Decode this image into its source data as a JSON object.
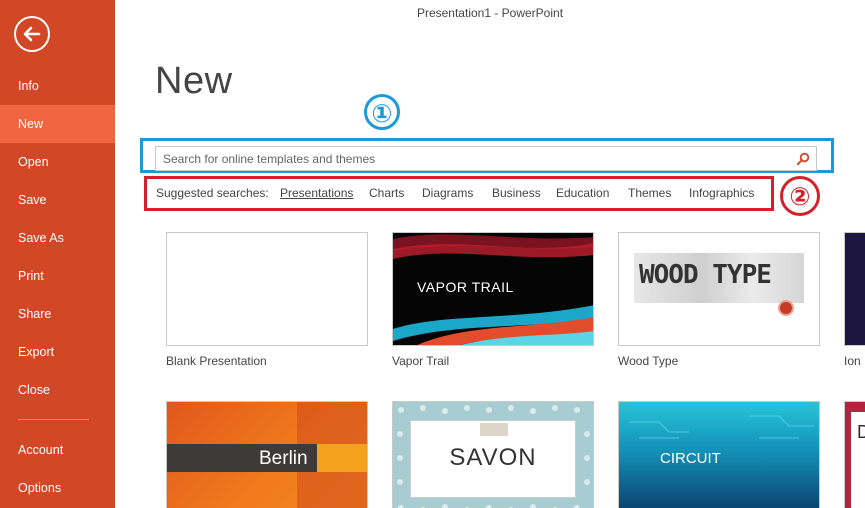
{
  "window": {
    "title": "Presentation1 - PowerPoint"
  },
  "sidebar": {
    "back_icon": "back-arrow-icon",
    "items": [
      {
        "label": "Info"
      },
      {
        "label": "New",
        "active": true
      },
      {
        "label": "Open"
      },
      {
        "label": "Save"
      },
      {
        "label": "Save As"
      },
      {
        "label": "Print"
      },
      {
        "label": "Share"
      },
      {
        "label": "Export"
      },
      {
        "label": "Close"
      },
      {
        "label": "Account"
      },
      {
        "label": "Options"
      }
    ]
  },
  "main": {
    "title": "New",
    "search": {
      "placeholder": "Search for online templates and themes",
      "value": "",
      "icon": "search-icon"
    },
    "suggested": {
      "label": "Suggested searches:",
      "items": [
        "Presentations",
        "Charts",
        "Diagrams",
        "Business",
        "Education",
        "Themes",
        "Infographics"
      ]
    },
    "annotations": {
      "one": "①",
      "two": "②"
    },
    "templates": [
      {
        "name": "Blank Presentation",
        "thumb_text": ""
      },
      {
        "name": "Vapor Trail",
        "thumb_text": "VAPOR TRAIL"
      },
      {
        "name": "Wood Type",
        "thumb_text": "WOOD TYPE"
      },
      {
        "name": "Ion",
        "thumb_text": ""
      },
      {
        "name": "",
        "thumb_text": "Berlin"
      },
      {
        "name": "",
        "thumb_text": "SAVON"
      },
      {
        "name": "",
        "thumb_text": "CIRCUIT"
      },
      {
        "name": "",
        "thumb_text": "D"
      }
    ]
  },
  "colors": {
    "sidebar": "#d24726",
    "sidebar_active": "#f0643f",
    "annotation_blue": "#1b9ad8",
    "annotation_red": "#d4202a"
  }
}
